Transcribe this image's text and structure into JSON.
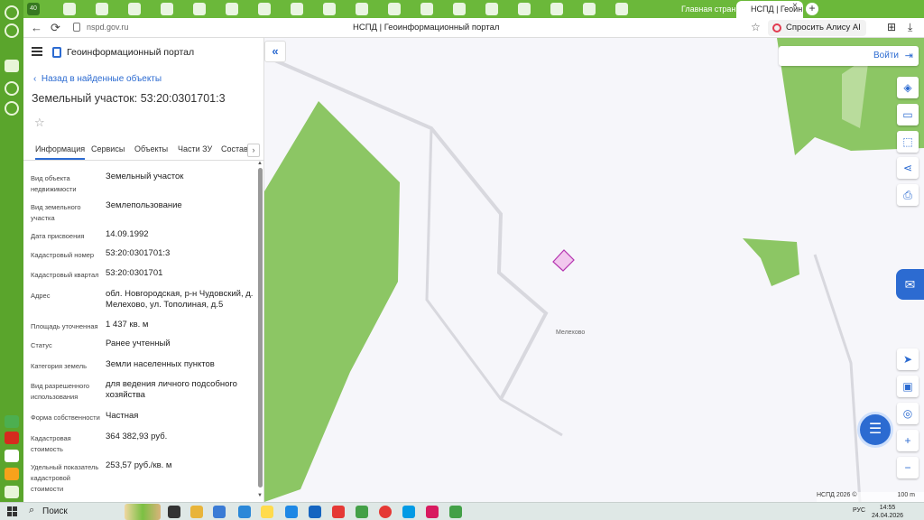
{
  "browser": {
    "tabs": {
      "first_badge": "40",
      "main_tab": "Главная страни",
      "active_tab": "НСПД | Геоин",
      "close": "×",
      "new": "+"
    },
    "address": {
      "back": "←",
      "reload": "⟳",
      "url": "nspd.gov.ru",
      "title": "НСПД | Геоинформационный портал",
      "bookmark": "☆",
      "alice_label": "Спросить Алису AI"
    }
  },
  "sidebar": {
    "portal_name": "Геоинформационный портал",
    "back_link": "Назад в найденные объекты",
    "parcel_title": "Земельный участок: 53:20:0301701:3",
    "favorite_icon": "☆",
    "tabs": [
      {
        "label": "Информация"
      },
      {
        "label": "Сервисы"
      },
      {
        "label": "Объекты"
      },
      {
        "label": "Части ЗУ"
      },
      {
        "label": "Состав"
      }
    ],
    "tabs_next": "›",
    "properties": [
      {
        "label": "Вид объекта недвижимости",
        "value": "Земельный участок"
      },
      {
        "label": "Вид земельного участка",
        "value": "Землепользование"
      },
      {
        "label": "Дата присвоения",
        "value": "14.09.1992"
      },
      {
        "label": "Кадастровый номер",
        "value": "53:20:0301701:3"
      },
      {
        "label": "Кадастровый квартал",
        "value": "53:20:0301701"
      },
      {
        "label": "Адрес",
        "value": "обл. Новгородская, р-н Чудовский, д. Мелехово, ул. Тополиная, д.5"
      },
      {
        "label": "Площадь уточненная",
        "value": "1 437 кв. м"
      },
      {
        "label": "Статус",
        "value": "Ранее учтенный"
      },
      {
        "label": "Категория земель",
        "value": "Земли населенных пунктов"
      },
      {
        "label": "Вид разрешенного использования",
        "value": "для ведения личного подсобного хозяйства"
      },
      {
        "label": "Форма собственности",
        "value": "Частная"
      },
      {
        "label": "Кадастровая стоимость",
        "value": "364 382,93 руб."
      },
      {
        "label": "Удельный показатель кадастровой стоимости",
        "value": "253,57 руб./кв. м"
      }
    ]
  },
  "map": {
    "collapse": "«",
    "login_label": "Войти",
    "village_label": "Мелехово",
    "footer_brand": "НСПД 2026 ©",
    "scale": "100 m",
    "zoom_in": "+",
    "zoom_out": "−",
    "colors": {
      "forest": "#8cc664",
      "road": "#d8d8de",
      "parcel_fill": "#f2c8ee",
      "parcel_stroke": "#b535b0",
      "accent": "#2c6bd1"
    }
  },
  "taskbar": {
    "search_label": "Поиск",
    "lang": "РУС",
    "time": "14:55",
    "date": "24.04.2026"
  }
}
